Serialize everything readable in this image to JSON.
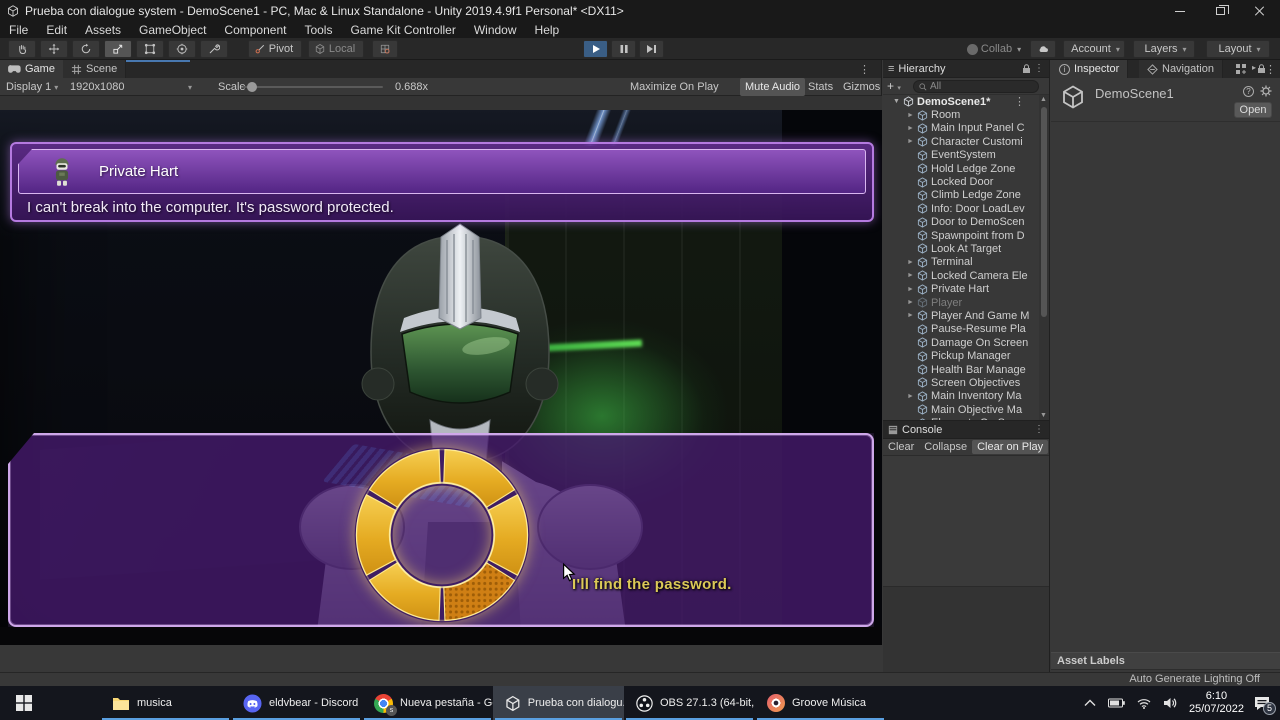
{
  "titlebar": {
    "title": "Prueba con dialogue system - DemoScene1 - PC, Mac & Linux Standalone - Unity 2019.4.9f1 Personal* <DX11>"
  },
  "menu": {
    "items": [
      "File",
      "Edit",
      "Assets",
      "GameObject",
      "Component",
      "Tools",
      "Game Kit Controller",
      "Window",
      "Help"
    ]
  },
  "toolbar": {
    "pivot": "Pivot",
    "local": "Local",
    "collab": "Collab",
    "account": "Account",
    "layers": "Layers",
    "layout": "Layout"
  },
  "game_panel": {
    "tab_game": "Game",
    "tab_scene": "Scene",
    "display": "Display 1",
    "resolution": "1920x1080",
    "scale_label": "Scale",
    "scale_value": "0.688x",
    "maximize": "Maximize On Play",
    "mute": "Mute Audio",
    "stats": "Stats",
    "gizmos": "Gizmos"
  },
  "game": {
    "speaker": "Private Hart",
    "dialogue": "I can't break into the computer. It's password protected.",
    "subtitle": "I'll find the password."
  },
  "hierarchy": {
    "title": "Hierarchy",
    "search": "All",
    "scene": "DemoScene1*",
    "items": [
      {
        "label": "Room",
        "expandable": true
      },
      {
        "label": "Main Input Panel C",
        "expandable": true
      },
      {
        "label": "Character Customi",
        "expandable": true
      },
      {
        "label": "EventSystem"
      },
      {
        "label": "Hold Ledge Zone"
      },
      {
        "label": "Locked Door"
      },
      {
        "label": "Climb Ledge Zone"
      },
      {
        "label": "Info: Door LoadLev"
      },
      {
        "label": "Door to DemoScen"
      },
      {
        "label": "Spawnpoint from D"
      },
      {
        "label": "Look At Target"
      },
      {
        "label": "Terminal",
        "expandable": true
      },
      {
        "label": "Locked Camera Ele",
        "expandable": true
      },
      {
        "label": "Private Hart",
        "expandable": true
      },
      {
        "label": "Player",
        "expandable": true,
        "disabled": true
      },
      {
        "label": "Player And Game M",
        "expandable": true
      },
      {
        "label": "Pause-Resume Pla"
      },
      {
        "label": "Damage On Screen"
      },
      {
        "label": "Pickup Manager"
      },
      {
        "label": "Health Bar Manage"
      },
      {
        "label": "Screen Objectives"
      },
      {
        "label": "Main Inventory Ma",
        "expandable": true
      },
      {
        "label": "Main Objective Ma"
      },
      {
        "label": "Elements On Scre"
      }
    ]
  },
  "console": {
    "title": "Console",
    "clear": "Clear",
    "collapse": "Collapse",
    "clear_on_play": "Clear on Play",
    "partial": "C"
  },
  "inspector": {
    "tab_inspector": "Inspector",
    "tab_navigation": "Navigation",
    "object_name": "DemoScene1",
    "open": "Open",
    "asset_labels": "Asset Labels",
    "lighting_status": "Auto Generate Lighting Off"
  },
  "taskbar": {
    "items": [
      {
        "label": "musica"
      },
      {
        "label": "eldvbear - Discord"
      },
      {
        "label": "Nueva pestaña - Go..."
      },
      {
        "label": "Prueba con dialogu...",
        "active": true
      },
      {
        "label": "OBS 27.1.3 (64-bit, ..."
      },
      {
        "label": "Groove Música"
      }
    ],
    "tray": {
      "time": "6:10",
      "date": "25/07/2022",
      "badge": "5"
    }
  },
  "colors": {
    "taskbar_accent": "#5a9fe0",
    "play_active": "#3a5e85",
    "dialogue_purple": "#5a2d87",
    "dialogue_border": "#b57ae0",
    "wheel_gold": "#e9b42c",
    "wheel_highlight": "#cf7f14",
    "subtitle_yellow": "#dcc957",
    "scene_green_glow": "#46d750"
  }
}
